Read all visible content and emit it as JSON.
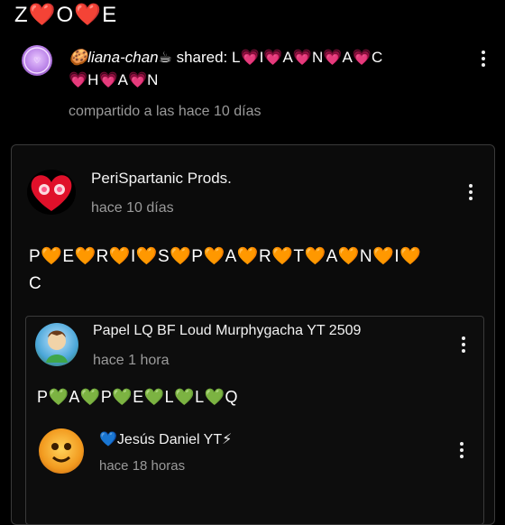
{
  "header": {
    "title": "Z❤️O❤️E"
  },
  "share": {
    "user": "🍪liana-chan☕",
    "action": " shared: ",
    "text_line1": "L💗I💗A💗N💗A💗C",
    "text_line2": "💗H💗A💗N",
    "meta": "compartido a las hace 10 días"
  },
  "post": {
    "author": "PeriSpartanic Prods.",
    "time": "hace 10 días",
    "line1": "P🧡E🧡R🧡I🧡S🧡P🧡A🧡R🧡T🧡A🧡N🧡I🧡",
    "line2": "C"
  },
  "comment1": {
    "author": "Papel LQ BF Loud Murphygacha YT 2509",
    "time": "hace 1 hora",
    "text": "P💚A💚P💚E💚L💚L💚Q"
  },
  "comment2": {
    "author": "💙Jesús Daniel YT⚡",
    "time": "hace 18 horas"
  },
  "colors": {
    "background": "#000000",
    "muted": "#9a9a9a",
    "card_border": "#3a3a3a"
  }
}
